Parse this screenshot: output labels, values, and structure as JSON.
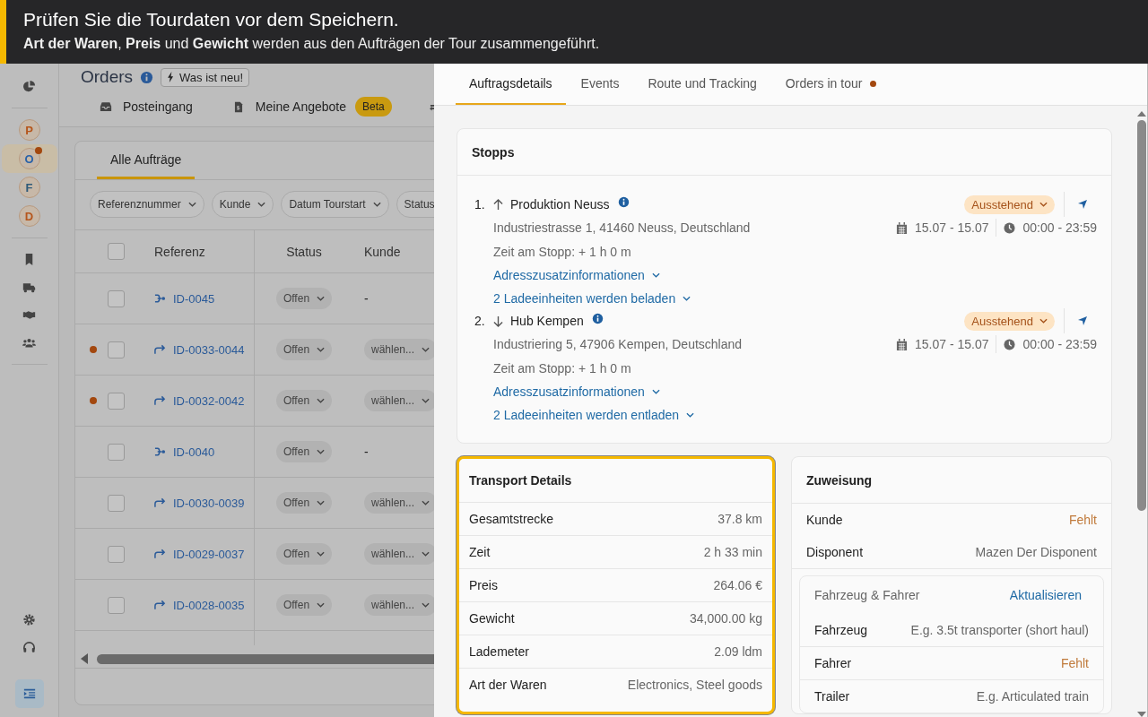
{
  "banner": {
    "title": "Prüfen Sie die Tourdaten vor dem Speichern.",
    "text": "**Art der Waren**, **Preis** und **Gewicht** werden aus den Aufträgen der Tour zusammengeführt."
  },
  "sidebar": {
    "avatars": [
      {
        "label": "P",
        "color": "#b5561c",
        "selected": false,
        "badge": false
      },
      {
        "label": "O",
        "color": "#2a62a8",
        "selected": true,
        "badge": true
      },
      {
        "label": "F",
        "color": "#2f5a78",
        "selected": false,
        "badge": false
      },
      {
        "label": "D",
        "color": "#b5561c",
        "selected": false,
        "badge": false
      }
    ]
  },
  "page": {
    "title": "Orders",
    "whats_new": "Was ist neu!",
    "nav": [
      {
        "label": "Posteingang",
        "kind": "inbox"
      },
      {
        "label": "Meine Angebote",
        "kind": "offers",
        "badge": "Beta"
      }
    ],
    "tabs": [
      {
        "label": "Alle Aufträge",
        "selected": true
      }
    ],
    "filters": [
      {
        "label": "Referenznummer",
        "cut": false
      },
      {
        "label": "Kunde",
        "cut": false
      },
      {
        "label": "Datum Tourstart",
        "cut": false
      },
      {
        "label": "Status",
        "cut": true
      }
    ],
    "table": {
      "columns": [
        "Referenz",
        "Status",
        "Kunde"
      ],
      "select_all_checked": false,
      "rows": [
        {
          "kind": "tour",
          "flagged": false,
          "checked": false,
          "reference": "ID-0045",
          "status": "Offen",
          "customer": "-",
          "customer_select": false
        },
        {
          "kind": "order",
          "flagged": true,
          "checked": false,
          "reference": "ID-0033-0044",
          "status": "Offen",
          "customer": "wählen...",
          "customer_select": true
        },
        {
          "kind": "order",
          "flagged": true,
          "checked": false,
          "reference": "ID-0032-0042",
          "status": "Offen",
          "customer": "wählen...",
          "customer_select": true
        },
        {
          "kind": "tour",
          "flagged": false,
          "checked": false,
          "reference": "ID-0040",
          "status": "Offen",
          "customer": "-",
          "customer_select": false
        },
        {
          "kind": "order",
          "flagged": false,
          "checked": false,
          "reference": "ID-0030-0039",
          "status": "Offen",
          "customer": "wählen...",
          "customer_select": true
        },
        {
          "kind": "order",
          "flagged": false,
          "checked": false,
          "reference": "ID-0029-0037",
          "status": "Offen",
          "customer": "wählen...",
          "customer_select": true
        },
        {
          "kind": "order",
          "flagged": false,
          "checked": false,
          "reference": "ID-0028-0035",
          "status": "Offen",
          "customer": "wählen...",
          "customer_select": true
        }
      ]
    }
  },
  "drawer": {
    "tabs": [
      {
        "label": "Auftragsdetails",
        "selected": true,
        "dot": false
      },
      {
        "label": "Events",
        "selected": false,
        "dot": false
      },
      {
        "label": "Route und Tracking",
        "selected": false,
        "dot": false
      },
      {
        "label": "Orders in tour",
        "selected": false,
        "dot": true
      }
    ],
    "stops": {
      "title": "Stopps",
      "items": [
        {
          "number": "1.",
          "kind": "up",
          "name": "Produktion Neuss",
          "status": "Ausstehend",
          "address": "Industriestrasse 1, 41460 Neuss, Deutschland",
          "dates": "15.07 - 15.07",
          "times": "00:00 - 23:59",
          "duration": "Zeit am Stopp: + 1 h 0 m",
          "info_link": "Adresszusatzinformationen",
          "loads_link": "2 Ladeeinheiten werden beladen"
        },
        {
          "number": "2.",
          "kind": "down",
          "name": "Hub Kempen",
          "status": "Ausstehend",
          "address": "Industriering 5, 47906 Kempen, Deutschland",
          "dates": "15.07 - 15.07",
          "times": "00:00 - 23:59",
          "duration": "Zeit am Stopp: + 1 h 0 m",
          "info_link": "Adresszusatzinformationen",
          "loads_link": "2 Ladeeinheiten werden entladen"
        }
      ]
    },
    "transport": {
      "title": "Transport Details",
      "highlighted": true,
      "rows": [
        {
          "label": "Gesamtstrecke",
          "value": "37.8 km"
        },
        {
          "label": "Zeit",
          "value": "2 h 33 min"
        },
        {
          "label": "Preis",
          "value": "264.06 €"
        },
        {
          "label": "Gewicht",
          "value": "34,000.00 kg"
        },
        {
          "label": "Lademeter",
          "value": "2.09 ldm"
        },
        {
          "label": "Art der Waren",
          "value": "Electronics, Steel goods"
        }
      ]
    },
    "assignment": {
      "title": "Zuweisung",
      "rows": [
        {
          "label": "Kunde",
          "value": "Fehlt",
          "missing": true
        },
        {
          "label": "Disponent",
          "value": "Mazen Der Disponent",
          "missing": false
        }
      ],
      "vehicle": {
        "title": "Fahrzeug & Fahrer",
        "action": "Aktualisieren",
        "rows": [
          {
            "label": "Fahrzeug",
            "value": "E.g. 3.5t transporter (short haul)",
            "missing": false
          },
          {
            "label": "Fahrer",
            "value": "Fehlt",
            "missing": true
          },
          {
            "label": "Trailer",
            "value": "E.g. Articulated train",
            "missing": false
          }
        ]
      }
    }
  }
}
